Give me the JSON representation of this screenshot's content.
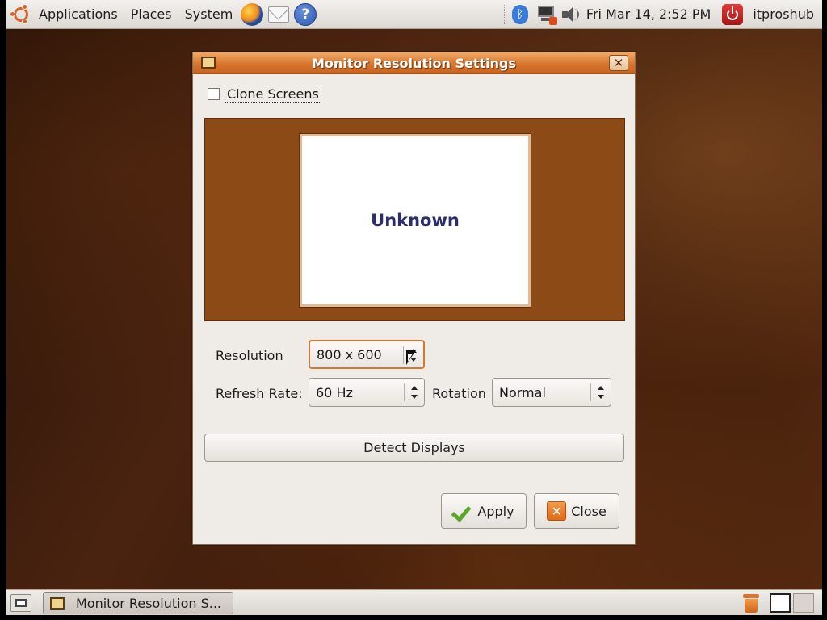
{
  "top_panel": {
    "menus": [
      "Applications",
      "Places",
      "System"
    ],
    "clock": "Fri Mar 14,  2:52 PM",
    "username": "itproshub"
  },
  "dialog": {
    "title": "Monitor Resolution Settings",
    "close_glyph": "✕",
    "clone_screens_label": "Clone Screens",
    "clone_screens_checked": false,
    "monitor_label": "Unknown",
    "resolution_label": "Resolution",
    "resolution_value": "800 x 600",
    "refresh_rate_label": "Refresh Rate:",
    "refresh_rate_value": "60 Hz",
    "rotation_label": "Rotation",
    "rotation_value": "Normal",
    "detect_displays_label": "Detect Displays",
    "apply_label": "Apply",
    "close_label": "Close"
  },
  "bottom_panel": {
    "task_label": "Monitor Resolution S..."
  },
  "colors": {
    "accent": "#d7762f",
    "monitor_area": "#8c4a17",
    "monitor_text": "#2d2d6b"
  }
}
